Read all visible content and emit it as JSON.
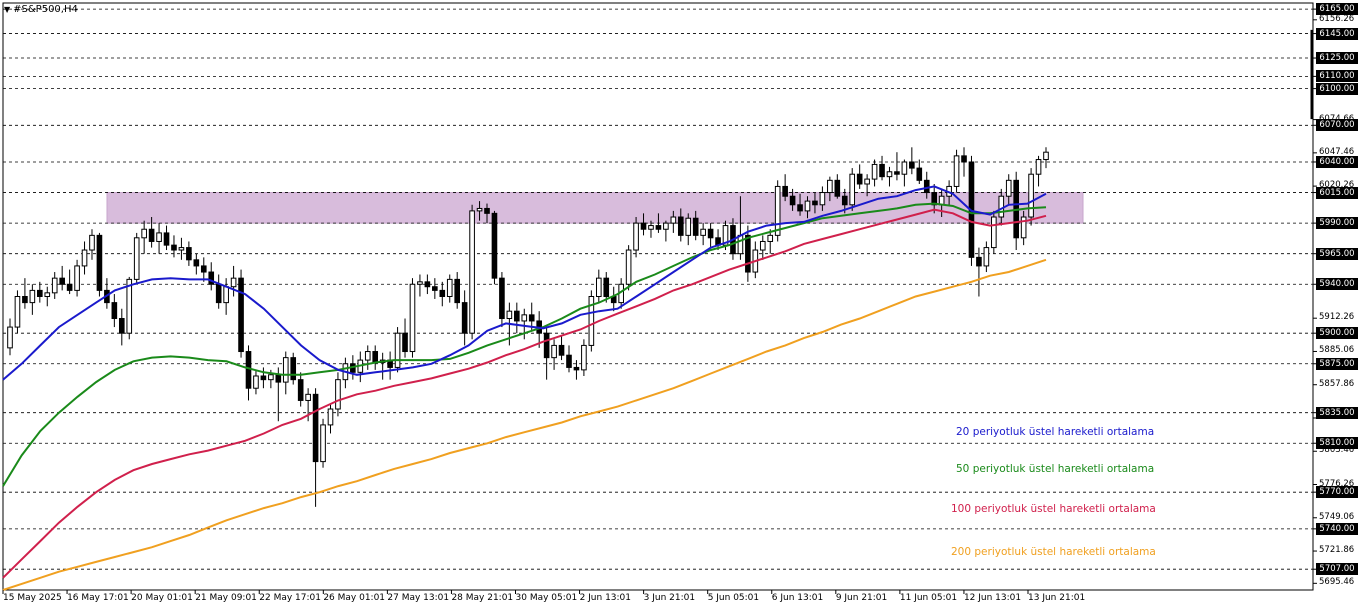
{
  "header": {
    "symbol_label": "#S&P500,H4",
    "menu_icon": "triangle-down-icon"
  },
  "legend": [
    {
      "text": "20 periyotluk üstel hareketli ortalama",
      "color": "#1a1acc"
    },
    {
      "text": "50 periyotluk üstel hareketli ortalama",
      "color": "#1a8a1a"
    },
    {
      "text": "100 periyotluk üstel hareketli ortalama",
      "color": "#d0204c"
    },
    {
      "text": "200 periyotluk üstel hareketli ortalama",
      "color": "#f0a020"
    }
  ],
  "chart_data": {
    "type": "candlestick",
    "title": "#S&P500,H4",
    "ylim": [
      5690,
      6170
    ],
    "y_ticks": [
      "6156.26",
      "6074.66",
      "6047.46",
      "6020.26",
      "5912.26",
      "5885.06",
      "5857.86",
      "5830.66",
      "5803.46",
      "5776.26",
      "5749.06",
      "5721.86",
      "5695.46"
    ],
    "levels": [
      6165,
      6145,
      6125,
      6110,
      6100,
      6070,
      6040,
      6015,
      5990,
      5965,
      5940,
      5900,
      5875,
      5835,
      5810,
      5770,
      5740,
      5707
    ],
    "level_labels": [
      "6165.00",
      "6145.00",
      "6125.00",
      "6110.00",
      "6100.00",
      "6070.00",
      "6040.00",
      "6015.00",
      "5990.00",
      "5965.00",
      "5940.00",
      "5900.00",
      "5875.00",
      "5835.00",
      "5810.00",
      "5770.00",
      "5740.00",
      "5707.00"
    ],
    "zone": {
      "from": 5990,
      "to": 6015,
      "color": "#d8bcdc"
    },
    "x_labels": [
      "15 May 2025",
      "16 May 17:01",
      "20 May 01:01",
      "21 May 09:01",
      "22 May 17:01",
      "26 May 01:01",
      "27 May 13:01",
      "28 May 21:01",
      "30 May 05:01",
      "2 Jun 13:01",
      "3 Jun 21:01",
      "5 Jun 05:01",
      "6 Jun 13:01",
      "9 Jun 21:01",
      "11 Jun 05:01",
      "12 Jun 13:01",
      "13 Jun 21:01"
    ],
    "candles": [
      [
        5888,
        5912,
        5882,
        5905
      ],
      [
        5905,
        5935,
        5900,
        5930
      ],
      [
        5930,
        5945,
        5920,
        5925
      ],
      [
        5925,
        5940,
        5915,
        5935
      ],
      [
        5935,
        5942,
        5925,
        5930
      ],
      [
        5930,
        5938,
        5922,
        5933
      ],
      [
        5933,
        5950,
        5928,
        5945
      ],
      [
        5945,
        5955,
        5935,
        5940
      ],
      [
        5940,
        5952,
        5932,
        5935
      ],
      [
        5935,
        5960,
        5930,
        5955
      ],
      [
        5955,
        5975,
        5948,
        5968
      ],
      [
        5968,
        5985,
        5960,
        5980
      ],
      [
        5980,
        5982,
        5930,
        5935
      ],
      [
        5935,
        5945,
        5920,
        5925
      ],
      [
        5925,
        5932,
        5905,
        5912
      ],
      [
        5912,
        5920,
        5890,
        5900
      ],
      [
        5900,
        5946,
        5895,
        5944
      ],
      [
        5944,
        5982,
        5940,
        5978
      ],
      [
        5978,
        5992,
        5965,
        5985
      ],
      [
        5985,
        5995,
        5970,
        5975
      ],
      [
        5975,
        5990,
        5965,
        5982
      ],
      [
        5982,
        5988,
        5968,
        5972
      ],
      [
        5972,
        5980,
        5962,
        5968
      ],
      [
        5968,
        5978,
        5960,
        5970
      ],
      [
        5970,
        5975,
        5955,
        5960
      ],
      [
        5960,
        5965,
        5948,
        5955
      ],
      [
        5955,
        5962,
        5942,
        5950
      ],
      [
        5950,
        5958,
        5935,
        5940
      ],
      [
        5940,
        5948,
        5920,
        5925
      ],
      [
        5925,
        5945,
        5915,
        5938
      ],
      [
        5938,
        5955,
        5930,
        5945
      ],
      [
        5945,
        5952,
        5880,
        5885
      ],
      [
        5885,
        5890,
        5845,
        5855
      ],
      [
        5855,
        5870,
        5850,
        5865
      ],
      [
        5865,
        5872,
        5855,
        5862
      ],
      [
        5862,
        5870,
        5855,
        5866
      ],
      [
        5866,
        5872,
        5828,
        5860
      ],
      [
        5860,
        5885,
        5850,
        5880
      ],
      [
        5880,
        5884,
        5858,
        5862
      ],
      [
        5862,
        5868,
        5840,
        5845
      ],
      [
        5845,
        5855,
        5828,
        5850
      ],
      [
        5850,
        5855,
        5758,
        5795
      ],
      [
        5795,
        5830,
        5790,
        5825
      ],
      [
        5825,
        5842,
        5818,
        5838
      ],
      [
        5838,
        5868,
        5832,
        5862
      ],
      [
        5862,
        5880,
        5855,
        5875
      ],
      [
        5875,
        5882,
        5862,
        5868
      ],
      [
        5868,
        5885,
        5860,
        5878
      ],
      [
        5878,
        5890,
        5870,
        5885
      ],
      [
        5885,
        5890,
        5870,
        5876
      ],
      [
        5876,
        5884,
        5862,
        5878
      ],
      [
        5878,
        5885,
        5862,
        5872
      ],
      [
        5872,
        5905,
        5868,
        5900
      ],
      [
        5900,
        5912,
        5880,
        5885
      ],
      [
        5885,
        5945,
        5880,
        5940
      ],
      [
        5940,
        5948,
        5930,
        5942
      ],
      [
        5942,
        5948,
        5932,
        5938
      ],
      [
        5938,
        5945,
        5928,
        5935
      ],
      [
        5935,
        5942,
        5922,
        5930
      ],
      [
        5930,
        5948,
        5925,
        5944
      ],
      [
        5944,
        5950,
        5920,
        5925
      ],
      [
        5925,
        5935,
        5890,
        5900
      ],
      [
        5900,
        6005,
        5895,
        6000
      ],
      [
        6000,
        6008,
        5992,
        6002
      ],
      [
        6002,
        6006,
        5990,
        5998
      ],
      [
        5998,
        6000,
        5940,
        5945
      ],
      [
        5945,
        5950,
        5905,
        5912
      ],
      [
        5912,
        5925,
        5890,
        5918
      ],
      [
        5918,
        5925,
        5900,
        5910
      ],
      [
        5910,
        5920,
        5895,
        5915
      ],
      [
        5915,
        5925,
        5902,
        5910
      ],
      [
        5910,
        5918,
        5888,
        5900
      ],
      [
        5900,
        5905,
        5862,
        5880
      ],
      [
        5880,
        5895,
        5870,
        5890
      ],
      [
        5890,
        5898,
        5878,
        5882
      ],
      [
        5882,
        5890,
        5868,
        5872
      ],
      [
        5872,
        5878,
        5862,
        5870
      ],
      [
        5870,
        5895,
        5865,
        5890
      ],
      [
        5890,
        5935,
        5885,
        5930
      ],
      [
        5930,
        5952,
        5925,
        5945
      ],
      [
        5945,
        5950,
        5925,
        5930
      ],
      [
        5930,
        5938,
        5918,
        5925
      ],
      [
        5925,
        5945,
        5920,
        5940
      ],
      [
        5940,
        5972,
        5935,
        5968
      ],
      [
        5968,
        5995,
        5962,
        5990
      ],
      [
        5990,
        5998,
        5980,
        5985
      ],
      [
        5985,
        5992,
        5978,
        5988
      ],
      [
        5988,
        5998,
        5982,
        5985
      ],
      [
        5985,
        5992,
        5975,
        5990
      ],
      [
        5990,
        6000,
        5982,
        5995
      ],
      [
        5995,
        6002,
        5975,
        5980
      ],
      [
        5980,
        5998,
        5972,
        5994
      ],
      [
        5994,
        6000,
        5976,
        5980
      ],
      [
        5980,
        5990,
        5972,
        5985
      ],
      [
        5985,
        5990,
        5970,
        5978
      ],
      [
        5978,
        5985,
        5968,
        5972
      ],
      [
        5972,
        5992,
        5968,
        5988
      ],
      [
        5988,
        5994,
        5960,
        5965
      ],
      [
        5965,
        6012,
        5960,
        5980
      ],
      [
        5980,
        5988,
        5942,
        5950
      ],
      [
        5950,
        5975,
        5945,
        5968
      ],
      [
        5968,
        5980,
        5960,
        5975
      ],
      [
        5975,
        5985,
        5965,
        5980
      ],
      [
        5980,
        6025,
        5975,
        6020
      ],
      [
        6020,
        6030,
        6008,
        6012
      ],
      [
        6012,
        6018,
        6000,
        6005
      ],
      [
        6005,
        6014,
        5996,
        6000
      ],
      [
        6000,
        6012,
        5994,
        6008
      ],
      [
        6008,
        6015,
        5998,
        6005
      ],
      [
        6005,
        6020,
        6000,
        6015
      ],
      [
        6015,
        6028,
        6008,
        6025
      ],
      [
        6025,
        6030,
        6010,
        6012
      ],
      [
        6012,
        6018,
        5998,
        6005
      ],
      [
        6005,
        6035,
        6000,
        6030
      ],
      [
        6030,
        6038,
        6018,
        6022
      ],
      [
        6022,
        6030,
        6012,
        6026
      ],
      [
        6026,
        6042,
        6020,
        6038
      ],
      [
        6038,
        6045,
        6025,
        6028
      ],
      [
        6028,
        6036,
        6020,
        6032
      ],
      [
        6032,
        6048,
        6025,
        6030
      ],
      [
        6030,
        6042,
        6020,
        6040
      ],
      [
        6040,
        6052,
        6030,
        6035
      ],
      [
        6035,
        6042,
        6022,
        6025
      ],
      [
        6025,
        6032,
        6010,
        6015
      ],
      [
        6015,
        6022,
        5998,
        6005
      ],
      [
        6005,
        6018,
        5995,
        6012
      ],
      [
        6012,
        6025,
        6005,
        6020
      ],
      [
        6020,
        6050,
        6015,
        6045
      ],
      [
        6045,
        6052,
        6028,
        6040
      ],
      [
        6040,
        6045,
        5955,
        5962
      ],
      [
        5962,
        5970,
        5930,
        5955
      ],
      [
        5955,
        5975,
        5950,
        5970
      ],
      [
        5970,
        6000,
        5965,
        5995
      ],
      [
        5995,
        6018,
        5988,
        6012
      ],
      [
        6012,
        6030,
        6005,
        6025
      ],
      [
        6025,
        6032,
        5968,
        5978
      ],
      [
        5978,
        6000,
        5972,
        5995
      ],
      [
        5995,
        6035,
        5988,
        6030
      ],
      [
        6030,
        6045,
        6020,
        6042
      ],
      [
        6042,
        6052,
        6035,
        6048
      ]
    ],
    "ema20": [
      5862,
      5875,
      5890,
      5905,
      5915,
      5925,
      5935,
      5940,
      5944,
      5945,
      5944,
      5944,
      5938,
      5932,
      5920,
      5905,
      5890,
      5878,
      5870,
      5866,
      5868,
      5870,
      5872,
      5875,
      5882,
      5890,
      5902,
      5908,
      5906,
      5904,
      5908,
      5915,
      5918,
      5920,
      5930,
      5940,
      5950,
      5960,
      5970,
      5975,
      5983,
      5988,
      5990,
      5991,
      5996,
      6000,
      6005,
      6010,
      6012,
      6017,
      6020,
      6014,
      6000,
      5997,
      6005,
      6006,
      6014
    ],
    "ema50": [
      5775,
      5800,
      5820,
      5835,
      5848,
      5860,
      5870,
      5877,
      5880,
      5881,
      5880,
      5878,
      5877,
      5872,
      5868,
      5866,
      5866,
      5868,
      5870,
      5873,
      5876,
      5878,
      5878,
      5878,
      5879,
      5884,
      5890,
      5895,
      5900,
      5905,
      5912,
      5920,
      5925,
      5932,
      5942,
      5948,
      5955,
      5962,
      5968,
      5972,
      5978,
      5982,
      5986,
      5990,
      5994,
      5996,
      5998,
      6000,
      6002,
      6005,
      6006,
      6004,
      5998,
      5998,
      6000,
      6002,
      6003
    ],
    "ema100": [
      5700,
      5715,
      5730,
      5745,
      5758,
      5770,
      5780,
      5788,
      5793,
      5797,
      5801,
      5804,
      5808,
      5812,
      5818,
      5825,
      5830,
      5838,
      5845,
      5850,
      5853,
      5857,
      5860,
      5863,
      5867,
      5871,
      5876,
      5882,
      5887,
      5893,
      5898,
      5903,
      5910,
      5916,
      5922,
      5928,
      5935,
      5940,
      5946,
      5952,
      5957,
      5962,
      5967,
      5973,
      5977,
      5981,
      5985,
      5989,
      5993,
      5997,
      6001,
      5998,
      5991,
      5988,
      5990,
      5992,
      5996
    ],
    "ema200": [
      5690,
      5695,
      5700,
      5705,
      5709,
      5713,
      5717,
      5721,
      5725,
      5730,
      5735,
      5741,
      5747,
      5752,
      5757,
      5761,
      5766,
      5770,
      5775,
      5779,
      5784,
      5789,
      5793,
      5797,
      5802,
      5806,
      5810,
      5815,
      5819,
      5823,
      5827,
      5832,
      5836,
      5840,
      5845,
      5850,
      5855,
      5861,
      5867,
      5873,
      5879,
      5885,
      5890,
      5896,
      5901,
      5907,
      5912,
      5918,
      5924,
      5930,
      5934,
      5938,
      5942,
      5947,
      5950,
      5955,
      5960
    ]
  }
}
